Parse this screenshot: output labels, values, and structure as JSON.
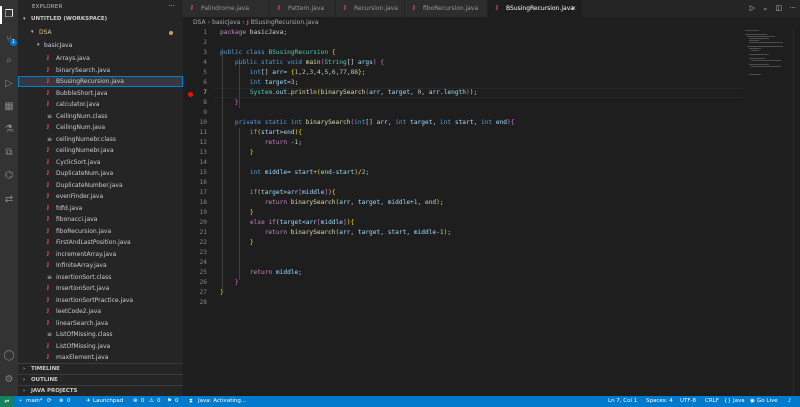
{
  "explorer": {
    "title": "EXPLORER",
    "workspace": "UNTITLED (WORKSPACE)",
    "root": "DSA",
    "folder": "basicJava",
    "files": [
      {
        "name": "Arrays.java",
        "type": "java"
      },
      {
        "name": "binarySearch.java",
        "type": "java"
      },
      {
        "name": "BSusingRecursion.java",
        "type": "java",
        "selected": true
      },
      {
        "name": "BubbleShort.java",
        "type": "java"
      },
      {
        "name": "calculator.java",
        "type": "java"
      },
      {
        "name": "CeilingNum.class",
        "type": "class"
      },
      {
        "name": "CeilingNum.java",
        "type": "java"
      },
      {
        "name": "ceilingNumebr.class",
        "type": "class"
      },
      {
        "name": "ceilingNumebr.java",
        "type": "java"
      },
      {
        "name": "CyclicSort.java",
        "type": "java"
      },
      {
        "name": "DuplicateNum.java",
        "type": "java"
      },
      {
        "name": "DuplicateNumber.java",
        "type": "java"
      },
      {
        "name": "evenFinder.java",
        "type": "java"
      },
      {
        "name": "fdfd.java",
        "type": "java"
      },
      {
        "name": "fibonacci.java",
        "type": "java"
      },
      {
        "name": "fiboRecursion.java",
        "type": "java"
      },
      {
        "name": "FirstAndLastPosition.java",
        "type": "java"
      },
      {
        "name": "incrementArray.java",
        "type": "java"
      },
      {
        "name": "InfiniteArray.java",
        "type": "java"
      },
      {
        "name": "insertionSort.class",
        "type": "class"
      },
      {
        "name": "InsertionSort.java",
        "type": "java"
      },
      {
        "name": "InsertionSortPractice.java",
        "type": "java"
      },
      {
        "name": "leetCode2.java",
        "type": "java"
      },
      {
        "name": "linearSearch.java",
        "type": "java"
      },
      {
        "name": "ListOfMissing.class",
        "type": "class"
      },
      {
        "name": "ListOfMissing.java",
        "type": "java"
      },
      {
        "name": "maxElement.java",
        "type": "java"
      }
    ],
    "sections": [
      "TIMELINE",
      "OUTLINE",
      "JAVA PROJECTS"
    ]
  },
  "tabs": [
    {
      "label": "Palindrome.java",
      "active": false
    },
    {
      "label": "Pattern.java",
      "active": false
    },
    {
      "label": "Recursion.java",
      "active": false
    },
    {
      "label": "fiboRecursion.java",
      "active": false
    },
    {
      "label": "BSusingRecursion.java",
      "active": true
    }
  ],
  "breadcrumb": [
    "DSA",
    "basicJava",
    "BSusingRecursion.java"
  ],
  "editor": {
    "line_numbers": [
      "1",
      "2",
      "3",
      "4",
      "5",
      "6",
      "7",
      "8",
      "9",
      "10",
      "11",
      "12",
      "13",
      "14",
      "15",
      "16",
      "17",
      "18",
      "19",
      "20",
      "21",
      "22",
      "23",
      "24",
      "25",
      "26",
      "27",
      "28"
    ],
    "breakpoint_line": 7,
    "current_line": 7
  },
  "status": {
    "branch": "main*",
    "launchpad": "Launchpad",
    "errors": "0",
    "warnings": "0",
    "info": "0",
    "java": "Java: Activating...",
    "position": "Ln 7, Col 1",
    "spaces": "Spaces: 4",
    "encoding": "UTF-8",
    "eol": "CRLF",
    "language": "Java",
    "golive": "Go Live"
  },
  "colors": {
    "accent": "#007acc",
    "remote": "#16825d",
    "java_icon": "#f14c4c",
    "breakpoint": "#e51400"
  }
}
